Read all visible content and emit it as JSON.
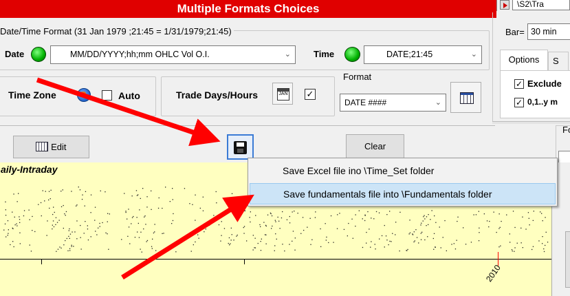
{
  "window": {
    "title": "Multiple Formats Choices"
  },
  "right_panel": {
    "bar_label": "Bar=",
    "bar_value": "30 min",
    "tab_options": "Options",
    "tab_s": "S",
    "exclude_label": "Exclude",
    "range_label": "0,1..y m",
    "fo_label": "Fo",
    "top_field_value": "\\S2\\Tra"
  },
  "format": {
    "header": "Date/Time Format (31 Jan 1979 ;21:45 =  1/31/1979;21:45)",
    "date_label": "Date",
    "date_value": "MM/DD/YYYY;hh;mm  OHLC Vol O.I.",
    "time_label": "Time",
    "time_value": "DATE;21:45",
    "format_label": "Format",
    "format_value": "DATE ####"
  },
  "timezone": {
    "label": "Time Zone",
    "auto_label": "Auto"
  },
  "trade_days": {
    "label": "Trade Days/Hours",
    "checked": true
  },
  "toolbar": {
    "edit_label": "Edit",
    "clear_label": "Clear"
  },
  "chart": {
    "title": "aily-Intraday",
    "year_label": "2010"
  },
  "context_menu": {
    "items": [
      "Save Excel file ino \\Time_Set folder",
      "Save fundamentals file into \\Fundamentals folder"
    ],
    "selected_index": 1
  },
  "colors": {
    "title_bg": "#e00000",
    "chart_bg": "#ffffc0",
    "highlight": "#cce4f7",
    "arrow": "#ff0000"
  }
}
